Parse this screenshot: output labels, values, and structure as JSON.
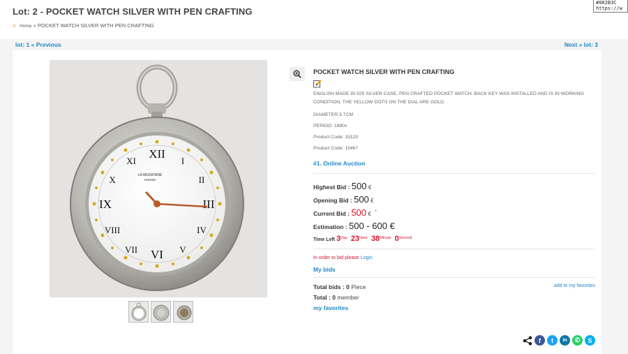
{
  "header": {
    "title": "Lot: 2 - POCKET WATCH SILVER WITH PEN CRAFTING",
    "breadcrumb_sep": "»",
    "breadcrumb_home": "Home",
    "breadcrumb_current": "POCKET WATCH SILVER WITH PEN CRAFTING"
  },
  "tooltip": {
    "line1": "#002B3C",
    "line2": "https://w"
  },
  "nav": {
    "previous": "lot: 1 « Previous",
    "next": "Next » lot: 3"
  },
  "product": {
    "title": "POCKET WATCH SILVER WITH PEN CRAFTING",
    "description": "ENGLISH MADE IN 925 SILVER CASE, PEN CRAFTED POCKET WATCH. BACK KEY WAS INSTALLED AND IS IN WORKING CONDITION. THE YELLOW DOTS ON THE DIAL ARE GOLD.",
    "diameter": "DIAMETER:3.7CM",
    "period": "PERIOD: 1890s",
    "product_code_1": "Product Code: 15120",
    "product_code_2": "Product Code: 15467",
    "auction": "#1. Online Auction",
    "dial_text_1": "LA MIGNONNE",
    "dial_text_2": "SUISSE"
  },
  "bids": {
    "highest_label": "Highest Bid :",
    "highest_value": "500",
    "opening_label": "Opening Bid :",
    "opening_value": "500",
    "current_label": "Current Bid :",
    "current_value": "500",
    "currency": "€",
    "estimation_label": "Estimation :",
    "estimation_value": "500 - 600 €"
  },
  "time_left": {
    "label": "Time Left",
    "days": "3",
    "days_unit": "Day",
    "hours": "23",
    "hours_unit": "Hour",
    "minutes": "38",
    "minutes_unit": "Minute",
    "seconds": "0",
    "seconds_unit": "Second"
  },
  "login": {
    "prefix": "In order to bid please",
    "link": "Login"
  },
  "links": {
    "my_bids": "My bids",
    "add_favorites": "add to my favorites",
    "my_favorites": "my favorites"
  },
  "stats": {
    "total_bids_label": "Total bids :",
    "total_bids_value": "0",
    "total_bids_unit": "Piece",
    "total_label": "Total :",
    "total_value": "0",
    "total_unit": "member"
  },
  "social": {
    "facebook": {
      "glyph": "f",
      "color": "#3b5998"
    },
    "twitter": {
      "glyph": "t",
      "color": "#1da1f2"
    },
    "linkedin": {
      "glyph": "in",
      "color": "#0e76a8"
    },
    "whatsapp": {
      "glyph": "✆",
      "color": "#25d366"
    },
    "skype": {
      "glyph": "S",
      "color": "#00aff0"
    }
  },
  "colors": {
    "link": "#1e88c7",
    "accent_red": "#d8132b",
    "breadcrumb_marker": "#e8a317"
  }
}
